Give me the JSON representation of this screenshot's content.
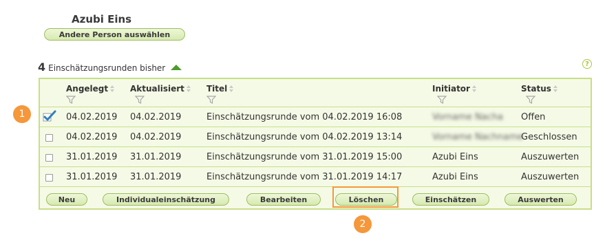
{
  "person": {
    "name": "Azubi Eins",
    "change_label": "Andere Person auswählen"
  },
  "rounds": {
    "count": "4",
    "title": "Einschätzungsrunden bisher",
    "help_label": "?"
  },
  "table": {
    "columns": [
      "Angelegt",
      "Aktualisiert",
      "Titel",
      "Initiator",
      "Status"
    ],
    "rows": [
      {
        "checked": true,
        "angelegt": "04.02.2019",
        "aktualisiert": "04.02.2019",
        "titel": "Einschätzungsrunde vom 04.02.2019 16:08",
        "initiator": "Vorname Nacha",
        "status": "Offen"
      },
      {
        "checked": false,
        "angelegt": "04.02.2019",
        "aktualisiert": "04.02.2019",
        "titel": "Einschätzungsrunde vom 04.02.2019 13:14",
        "initiator": "Vorname Nachname",
        "status": "Geschlossen"
      },
      {
        "checked": false,
        "angelegt": "31.01.2019",
        "aktualisiert": "31.01.2019",
        "titel": "Einschätzungsrunde vom 31.01.2019 15:00",
        "initiator": "Azubi Eins",
        "status": "Auszuwerten"
      },
      {
        "checked": false,
        "angelegt": "31.01.2019",
        "aktualisiert": "31.01.2019",
        "titel": "Einschätzungsrunde vom 31.01.2019 14:17",
        "initiator": "Azubi Eins",
        "status": "Auszuwerten"
      }
    ]
  },
  "buttons": {
    "neu": "Neu",
    "individual": "Individualeinschätzung",
    "bearbeiten": "Bearbeiten",
    "loeschen": "Löschen",
    "einschaetzen": "Einschätzen",
    "auswerten": "Auswerten"
  },
  "markers": [
    "1",
    "2"
  ],
  "colors": {
    "accent_green": "#4f9a2b",
    "table_border": "#c7de86",
    "table_bg": "#f5fae6",
    "marker_orange": "#f5973a"
  }
}
